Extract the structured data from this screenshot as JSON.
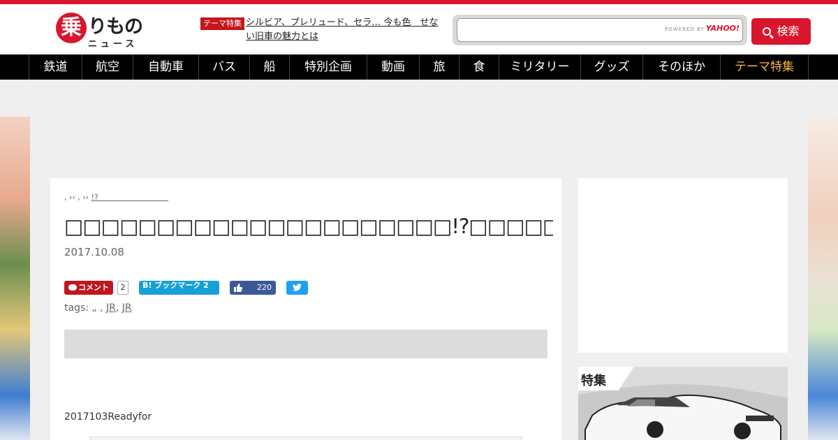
{
  "header": {
    "logo": {
      "kanji": "乗",
      "kana": "りもの",
      "sub": "ニュース"
    },
    "theme_badge": "テーマ特集",
    "theme_link": "シルビア、プレリュード、セラ… 今も色　せない旧車の魅力とは",
    "search": {
      "placeholder": "",
      "powered_by": "POWERED BY",
      "brand": "YAHOO!",
      "button_label": "検索"
    }
  },
  "nav": {
    "items": [
      {
        "label": "鉄道"
      },
      {
        "label": "航空"
      },
      {
        "label": "自動車"
      },
      {
        "label": "バス"
      },
      {
        "label": "船"
      },
      {
        "label": "特別企画"
      },
      {
        "label": "動画"
      },
      {
        "label": "旅"
      },
      {
        "label": "食"
      },
      {
        "label": "ミリタリー"
      },
      {
        "label": "グッズ"
      },
      {
        "label": "そのほか"
      },
      {
        "label": "テーマ特集"
      }
    ],
    "accent_color": "#f5b642"
  },
  "article": {
    "breadcrumb": {
      "prefix": ", ›› , ›› ",
      "current": "!?"
    },
    "title": "□□□□□□□□□□□□□□□□□□□□□!?□□□□□□□□□□□□□□□□□□□□□□□□□□□□□□",
    "date": "2017.10.08",
    "social": {
      "comment_label": "コメント",
      "comment_count": "2",
      "hatena_label": "B! ブックマーク 2",
      "fb_count": "220"
    },
    "tags_label": "tags:",
    "tags_prefix": " „ , ",
    "tags": [
      "JR",
      "JR"
    ],
    "body_text": "2017103Readyfor"
  },
  "sidebar": {
    "feature_label": "特集"
  },
  "colors": {
    "brand_red": "#d8162d",
    "nav_bg": "#000000",
    "hatena": "#17a0d8",
    "facebook": "#3b5998",
    "twitter": "#1da1f2"
  }
}
